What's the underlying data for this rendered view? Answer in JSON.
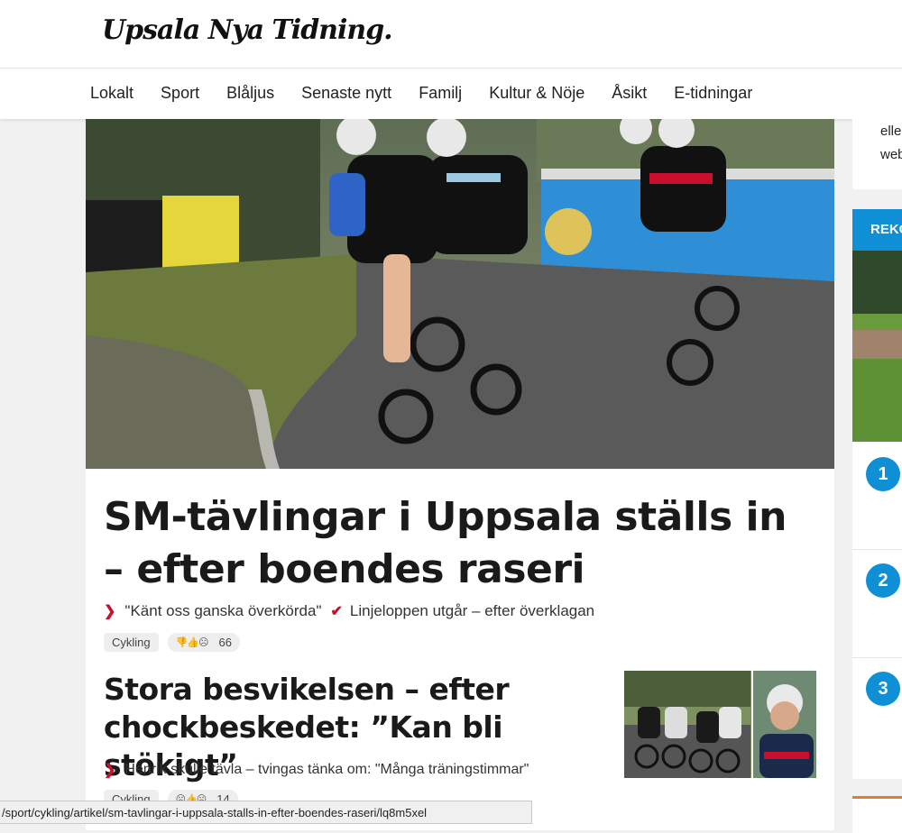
{
  "header": {
    "logo_text": "Upsala Nya Tidning."
  },
  "nav": {
    "items": [
      "Lokalt",
      "Sport",
      "Blåljus",
      "Senaste nytt",
      "Familj",
      "Kultur & Nöje",
      "Åsikt",
      "E-tidningar"
    ]
  },
  "article1": {
    "headline": "SM-tävlingar i Uppsala ställs in – efter boendes raseri",
    "related_1": "\"Känt oss ganska överkörda\"",
    "related_2": "Linjeloppen utgår – efter överklagan",
    "tag": "Cykling",
    "reaction_count": "66"
  },
  "article2": {
    "headline": "Stora besvikelsen – efter chockbeskedet: ”Kan bli stökigt”",
    "related_1": "Henrik skulle tävla – tvingas tänka om: \"Många träningstimmar\"",
    "tag": "Cykling",
    "reaction_count": "14"
  },
  "statusbar": {
    "url": "/sport/cykling/artikel/sm-tavlingar-i-uppsala-stalls-in-efter-boendes-raseri/lq8m5xel"
  },
  "sidebar": {
    "snippet_line1": "elle",
    "snippet_line2": "web",
    "list_header": "REKO",
    "numbers": [
      "1",
      "2",
      "3"
    ]
  },
  "colors": {
    "accent": "#0f8fd6",
    "red": "#c8102e",
    "sidebar_bottom_border": "#e07a3d"
  }
}
